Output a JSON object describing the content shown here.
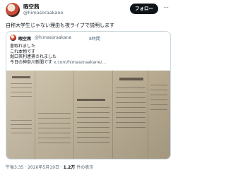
{
  "author": {
    "name": "暇空茜",
    "handle": "@himasoraakane"
  },
  "header": {
    "follow_label": "フォロー",
    "more_icon": "ellipsis-icon"
  },
  "tweet": {
    "text": "自称大学生じゃない理由も夜ライブで説明します"
  },
  "quote": {
    "name": "暇空茜",
    "handle": "@himasoraakane",
    "time": "8時間",
    "lines": [
      "書取れました",
      "これ本物です",
      "堀口英利逮捕されました",
      "今日の神奈川新聞です"
    ],
    "link": "x.com/himasoraakane/..."
  },
  "meta": {
    "timestamp": "午後3:35 · 2026年5月19日 · ",
    "views_count": "1.2万",
    "views_label": " 件の表示"
  }
}
